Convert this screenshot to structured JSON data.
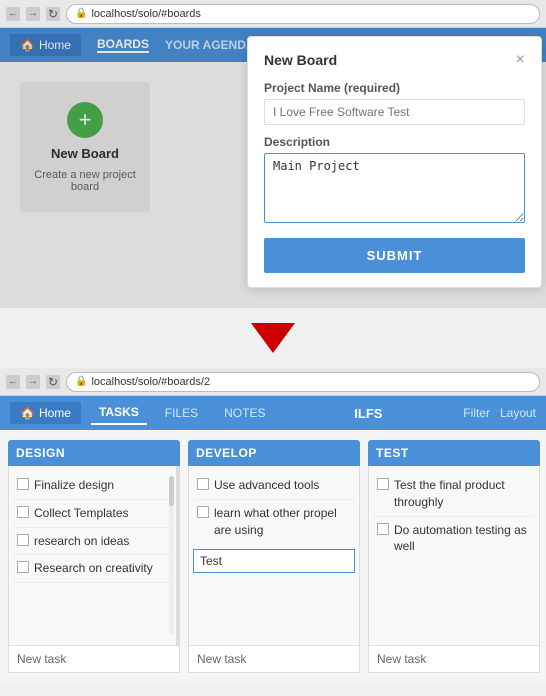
{
  "browser1": {
    "url": "localhost/solo/#boards",
    "back_label": "←",
    "forward_label": "→",
    "refresh_label": "↻"
  },
  "browser2": {
    "url": "localhost/solo/#boards/2",
    "back_label": "←",
    "forward_label": "→",
    "refresh_label": "↻"
  },
  "nav": {
    "home_label": "Home",
    "boards_label": "BOARDS",
    "agenda_label": "YOUR AGENDA"
  },
  "new_board_card": {
    "plus": "+",
    "title": "New Board",
    "subtitle": "Create a new project board"
  },
  "modal": {
    "title": "New Board",
    "close": "×",
    "project_name_label": "Project Name (required)",
    "project_name_placeholder": "I Love Free Software Test",
    "description_label": "Description",
    "description_value": "Main Project",
    "submit_label": "SUBMIT"
  },
  "board_nav": {
    "home_label": "Home",
    "tasks_label": "TASKS",
    "files_label": "FILES",
    "notes_label": "NOTES",
    "board_title": "ILFS",
    "filter_label": "Filter",
    "layout_label": "Layout"
  },
  "columns": {
    "design": {
      "header": "DESIGN",
      "tasks": [
        {
          "text": "Finalize design",
          "checked": false
        },
        {
          "text": "Collect Templates",
          "checked": false
        },
        {
          "text": "research on ideas",
          "checked": false
        },
        {
          "text": "Research on creativity",
          "checked": false
        }
      ],
      "new_task_label": "New task"
    },
    "develop": {
      "header": "DEVELOP",
      "tasks": [
        {
          "text": "Use advanced tools",
          "checked": false
        },
        {
          "text": "learn what other propel are using",
          "checked": false
        }
      ],
      "input_placeholder": "Test",
      "new_task_label": "New task"
    },
    "test": {
      "header": "TEST",
      "tasks": [
        {
          "text": "Test the final product throughly",
          "checked": false
        },
        {
          "text": "Do automation testing as well",
          "checked": false
        }
      ],
      "new_task_label": "New task"
    }
  }
}
